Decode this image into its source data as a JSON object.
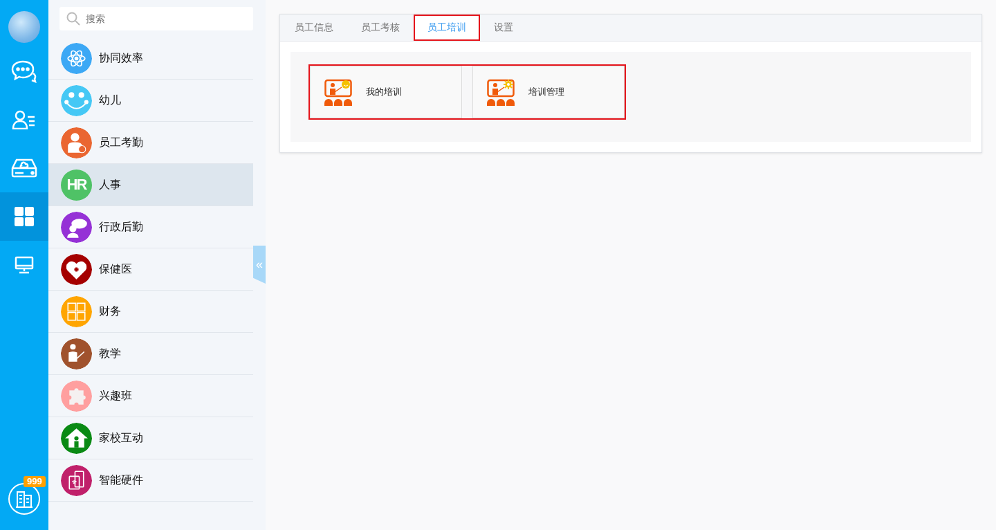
{
  "rail": {
    "items": [
      {
        "kind": "chat",
        "selected": false
      },
      {
        "kind": "contacts",
        "selected": false
      },
      {
        "kind": "drive",
        "selected": false
      },
      {
        "kind": "apps",
        "selected": true
      },
      {
        "kind": "monitor",
        "selected": false
      }
    ],
    "badge": "999"
  },
  "sidebar": {
    "search": {
      "placeholder": "搜索"
    },
    "collapse_glyph": "«",
    "items": [
      {
        "label": "协同效率",
        "color": "#3ca8f5",
        "selected": false
      },
      {
        "label": "幼儿",
        "color": "#45c8f5",
        "selected": false
      },
      {
        "label": "员工考勤",
        "color": "#ea6631",
        "selected": false
      },
      {
        "label": "人事",
        "color": "#4fc266",
        "selected": true,
        "icon_text": "HR"
      },
      {
        "label": "行政后勤",
        "color": "#9531d6",
        "selected": false
      },
      {
        "label": "保健医",
        "color": "#a50000",
        "selected": false
      },
      {
        "label": "财务",
        "color": "#ffa500",
        "selected": false
      },
      {
        "label": "教学",
        "color": "#a0522d",
        "selected": false
      },
      {
        "label": "兴趣班",
        "color": "#ff9f9f",
        "selected": false
      },
      {
        "label": "家校互动",
        "color": "#0a8a14",
        "selected": false
      },
      {
        "label": "智能硬件",
        "color": "#c0206a",
        "selected": false
      }
    ]
  },
  "tabs": [
    {
      "label": "员工信息",
      "selected": false,
      "marked": false
    },
    {
      "label": "员工考核",
      "selected": false,
      "marked": false
    },
    {
      "label": "员工培训",
      "selected": true,
      "marked": true
    },
    {
      "label": "设置",
      "selected": false,
      "marked": false
    }
  ],
  "cards_marked": true,
  "cards": [
    {
      "label": "我的培训",
      "kind": "smile"
    },
    {
      "label": "培训管理",
      "kind": "gear"
    }
  ]
}
